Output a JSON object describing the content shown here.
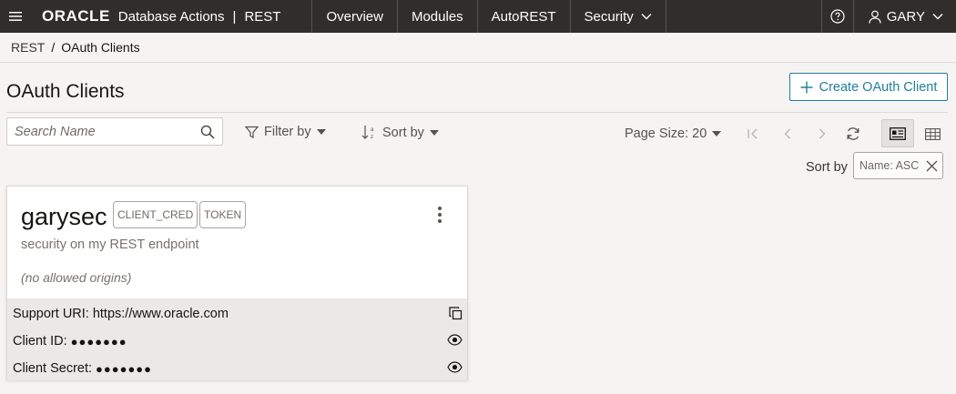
{
  "topbar": {
    "logo": "ORACLE",
    "product": "Database Actions",
    "separator": "|",
    "section": "REST",
    "nav": [
      "Overview",
      "Modules",
      "AutoREST",
      "Security"
    ],
    "user": "GARY",
    "icons": {
      "menu": "hamburger-icon",
      "help": "help-icon",
      "user": "user-icon",
      "chevron": "chevron-down-icon"
    }
  },
  "breadcrumb": {
    "parent": "REST",
    "separator": "/",
    "current": "OAuth Clients"
  },
  "page": {
    "title": "OAuth Clients",
    "create_button": "Create OAuth Client"
  },
  "toolbar": {
    "search_placeholder": "Search Name",
    "filter_label": "Filter by",
    "sort_label": "Sort by",
    "page_size_label": "Page Size: 20"
  },
  "sort_chip": {
    "label": "Sort by",
    "value": "Name: ASC"
  },
  "clients": [
    {
      "name": "garysec",
      "badges": [
        "CLIENT_CRED",
        "TOKEN"
      ],
      "description": "security on my REST endpoint",
      "origins": "(no allowed origins)",
      "support_uri_label": "Support URI:",
      "support_uri": "https://www.oracle.com",
      "client_id_label": "Client ID:",
      "client_id_masked": "●●●●●●●",
      "client_secret_label": "Client Secret:",
      "client_secret_masked": "●●●●●●●"
    }
  ],
  "colors": {
    "topbar": "#312d2a",
    "accent": "#227e9e",
    "background": "#f5f4f2"
  }
}
